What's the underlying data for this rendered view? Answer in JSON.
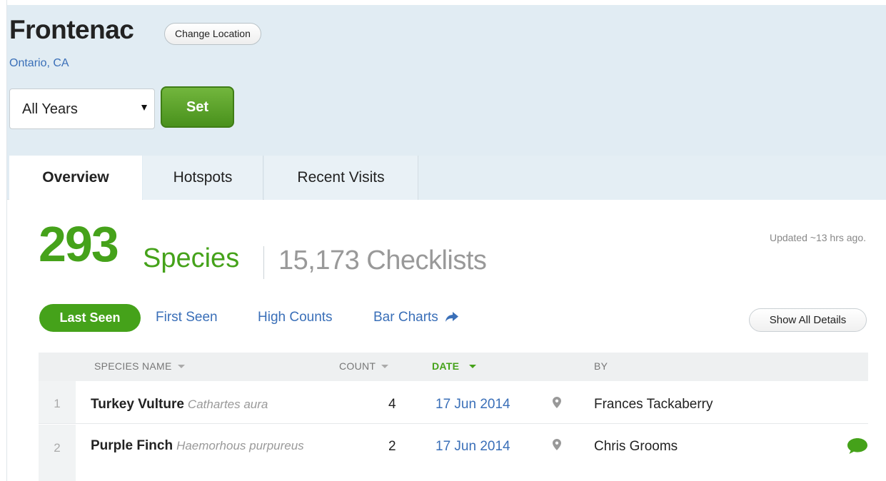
{
  "location": {
    "title": "Frontenac",
    "change_label": "Change Location",
    "region": "Ontario, CA"
  },
  "year_filter": {
    "selected": "All Years",
    "set_label": "Set"
  },
  "tabs": [
    {
      "label": "Overview",
      "active": true
    },
    {
      "label": "Hotspots",
      "active": false
    },
    {
      "label": "Recent Visits",
      "active": false
    }
  ],
  "stats": {
    "species_count": "293",
    "species_label": "Species",
    "checklists": "15,173 Checklists",
    "updated": "Updated ~13 hrs ago."
  },
  "subnav": {
    "last_seen": "Last Seen",
    "first_seen": "First Seen",
    "high_counts": "High Counts",
    "bar_charts": "Bar Charts",
    "show_all": "Show All Details"
  },
  "table": {
    "headers": {
      "species": "SPECIES NAME",
      "count": "COUNT",
      "date": "DATE",
      "by": "BY"
    },
    "rows": [
      {
        "index": "1",
        "common": "Turkey Vulture",
        "scientific": "Cathartes aura",
        "count": "4",
        "date": "17 Jun 2014",
        "observer": "Frances Tackaberry",
        "has_comment": false
      },
      {
        "index": "2",
        "common": "Purple Finch",
        "scientific": "Haemorhous purpureus",
        "count": "2",
        "date": "17 Jun 2014",
        "observer": "Chris Grooms",
        "has_comment": true
      }
    ]
  },
  "colors": {
    "accent_green": "#45a21a",
    "link_blue": "#3a6fb8",
    "header_bg": "#e1ecf3"
  }
}
